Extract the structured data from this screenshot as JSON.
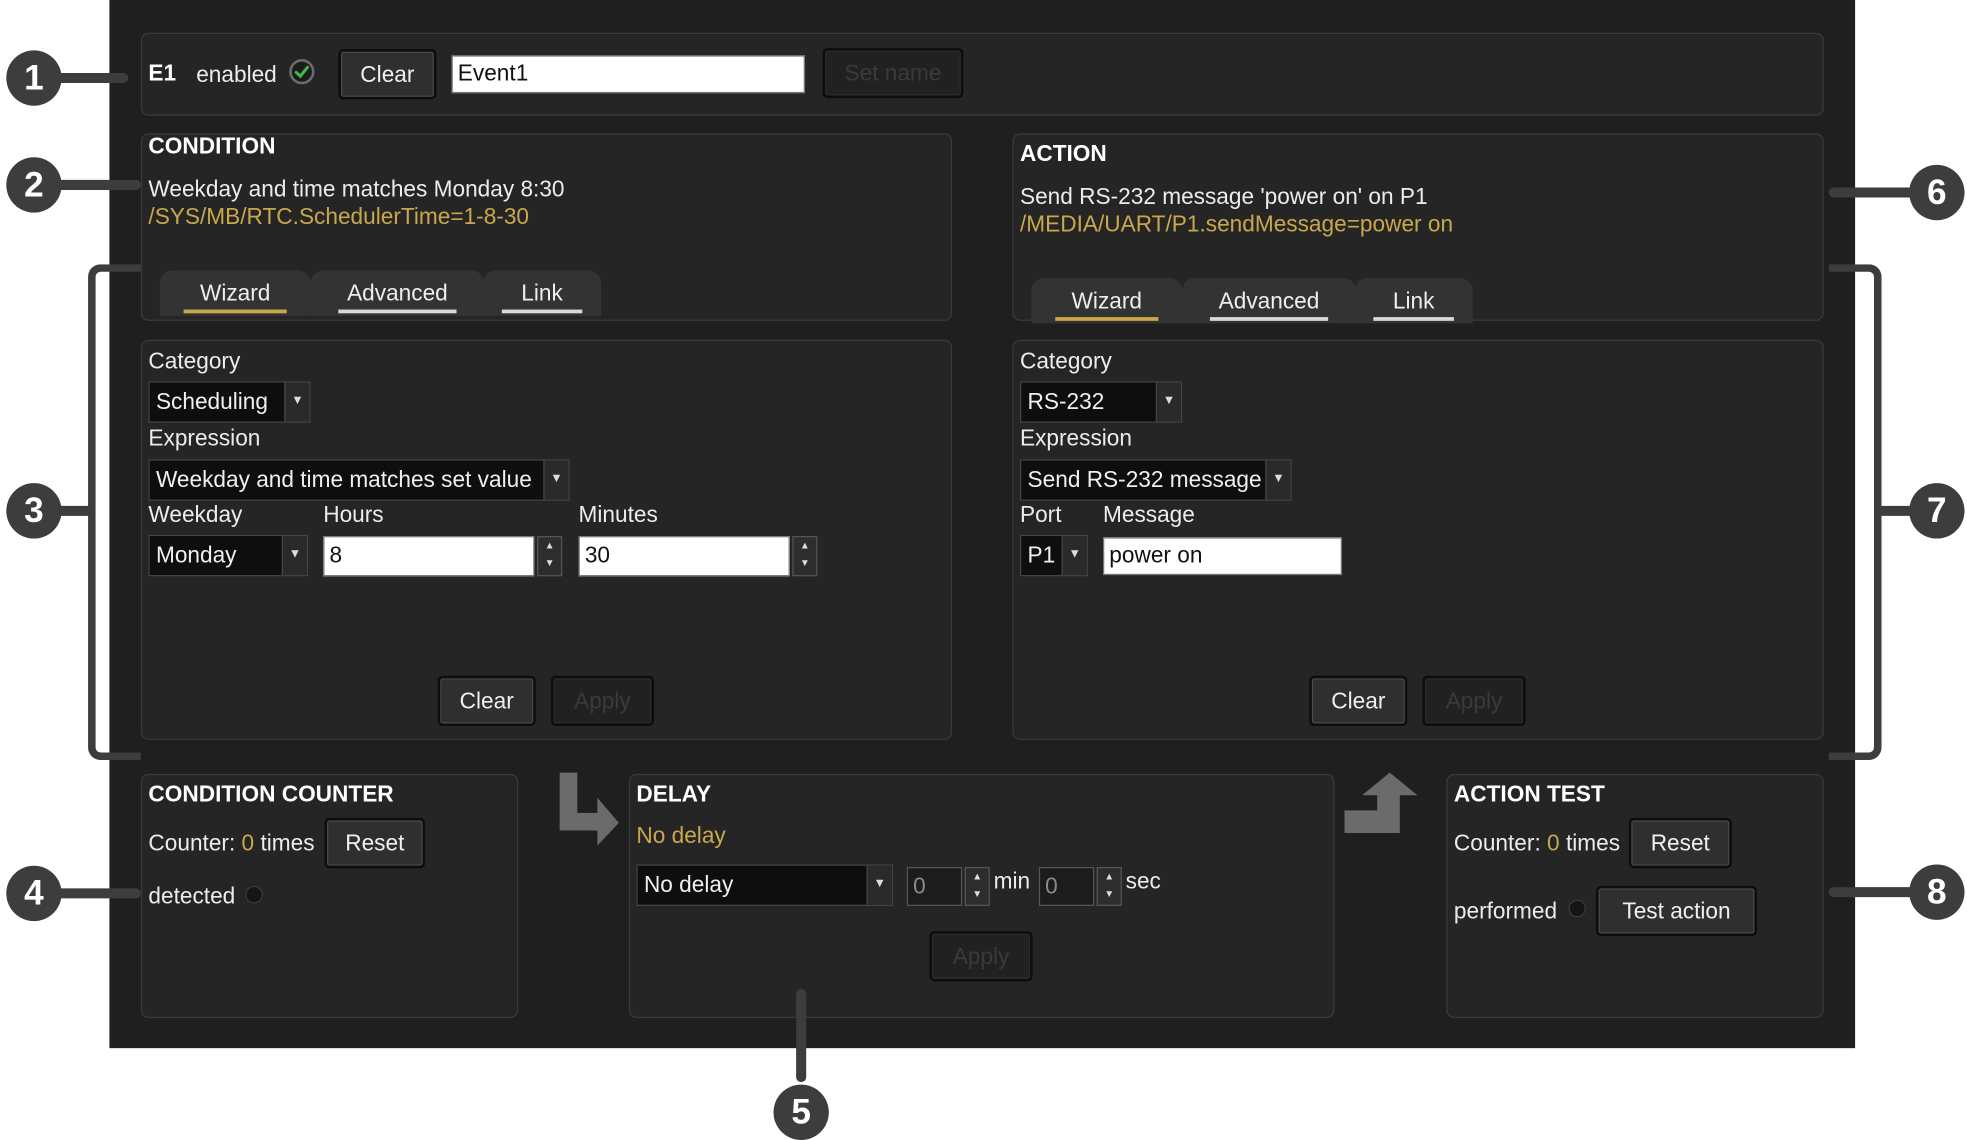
{
  "header": {
    "event_id": "E1",
    "enabled_label": "enabled",
    "clear_label": "Clear",
    "name_value": "Event1",
    "set_name_label": "Set name"
  },
  "condition": {
    "title": "CONDITION",
    "description": "Weekday and time matches Monday 8:30",
    "path": "/SYS/MB/RTC.SchedulerTime=1-8-30",
    "tabs": [
      "Wizard",
      "Advanced",
      "Link"
    ],
    "category_label": "Category",
    "category_value": "Scheduling",
    "expression_label": "Expression",
    "expression_value": "Weekday and time matches set value",
    "weekday_label": "Weekday",
    "weekday_value": "Monday",
    "hours_label": "Hours",
    "hours_value": "8",
    "minutes_label": "Minutes",
    "minutes_value": "30",
    "clear_label": "Clear",
    "apply_label": "Apply"
  },
  "action": {
    "title": "ACTION",
    "description": "Send RS-232 message 'power on' on P1",
    "path": "/MEDIA/UART/P1.sendMessage=power on",
    "tabs": [
      "Wizard",
      "Advanced",
      "Link"
    ],
    "category_label": "Category",
    "category_value": "RS-232",
    "expression_label": "Expression",
    "expression_value": "Send RS-232 message",
    "port_label": "Port",
    "port_value": "P1",
    "message_label": "Message",
    "message_value": "power on",
    "clear_label": "Clear",
    "apply_label": "Apply"
  },
  "condition_counter": {
    "title": "CONDITION COUNTER",
    "counter_prefix": "Counter:",
    "counter_value": "0",
    "counter_suffix": "times",
    "reset_label": "Reset",
    "detected_label": "detected"
  },
  "delay": {
    "title": "DELAY",
    "status": "No delay",
    "select_value": "No delay",
    "min_value": "0",
    "min_label": "min",
    "sec_value": "0",
    "sec_label": "sec",
    "apply_label": "Apply"
  },
  "action_test": {
    "title": "ACTION TEST",
    "counter_prefix": "Counter:",
    "counter_value": "0",
    "counter_suffix": "times",
    "reset_label": "Reset",
    "performed_label": "performed",
    "test_label": "Test action"
  },
  "callouts": [
    "1",
    "2",
    "3",
    "4",
    "5",
    "6",
    "7",
    "8"
  ],
  "colors": {
    "background": "#1f1f1f",
    "panel": "#252525",
    "accent": "#c9a84c",
    "callout": "#3d3d3d"
  }
}
